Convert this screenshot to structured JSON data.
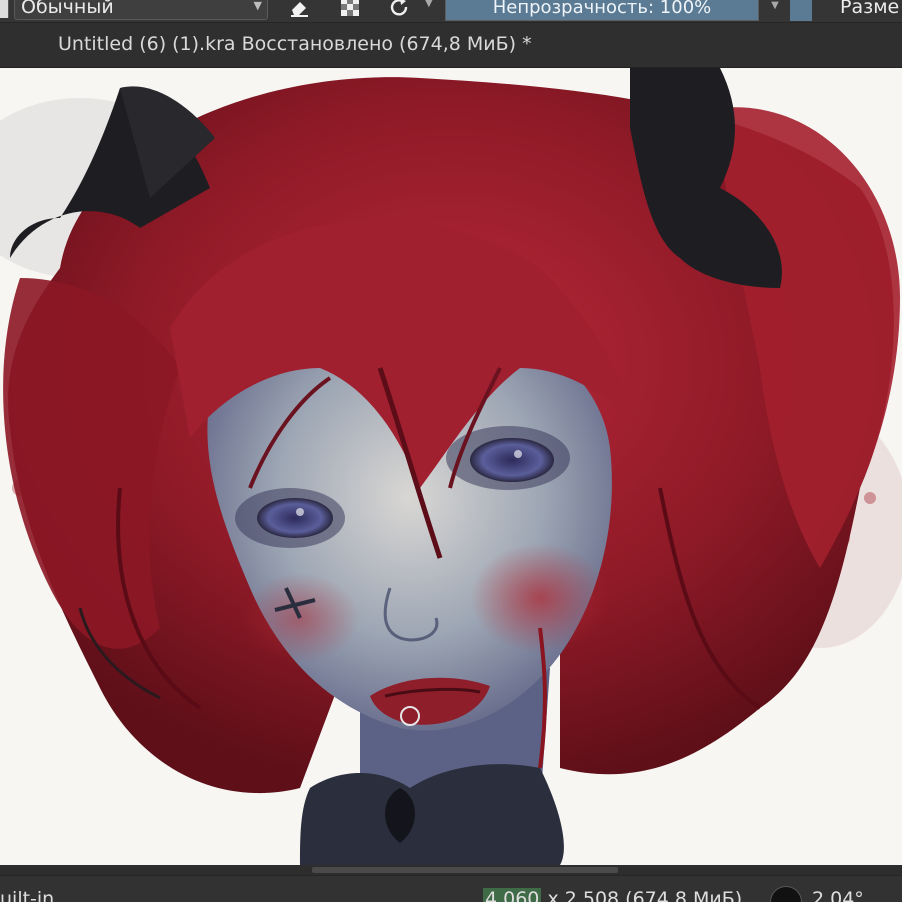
{
  "toolbar": {
    "blend_mode": "Обычный",
    "opacity_label": "Непрозрачность: 100%",
    "opacity_fraction": 1.0,
    "size_label": "Разме",
    "icons": [
      "eraser-icon",
      "alpha-lock-icon",
      "reload-preset-icon"
    ]
  },
  "document": {
    "title": "Untitled (6) (1).kra Восстановлено  (674,8 МиБ)  *"
  },
  "status": {
    "profile": "uilt-in",
    "dims_highlight": "4 060",
    "dims_rest": " x 2 508 (674,8 МиБ)",
    "rotation": "2,04°"
  },
  "colors": {
    "accent": "#5b7a93",
    "toolbar_bg": "#353535",
    "canvas_bg": "#f7f6f3",
    "hair_red": "#9c1c28",
    "bow_black": "#1e1e22"
  }
}
